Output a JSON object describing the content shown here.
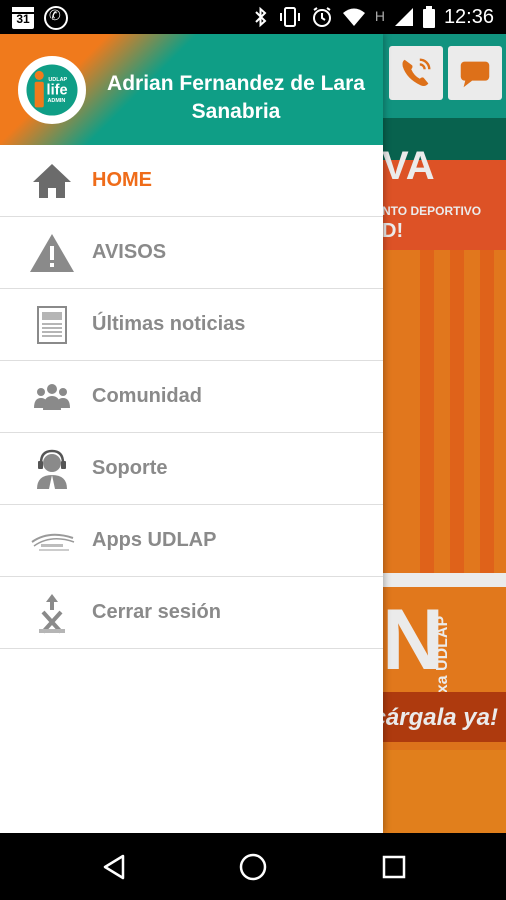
{
  "status_bar": {
    "calendar_date": "31",
    "time": "12:36",
    "network_label": "H",
    "icons": [
      "calendar-icon",
      "whatsapp-icon",
      "bluetooth-icon",
      "vibrate-icon",
      "alarm-icon",
      "wifi-icon",
      "signal-icon",
      "battery-icon"
    ]
  },
  "drawer": {
    "logo": {
      "name": "udlap-life-admin-logo",
      "text_top": "UDLAP",
      "text_main": "life",
      "text_sub": "ADMIN"
    },
    "user_name": "Adrian Fernandez de Lara Sanabria",
    "menu": [
      {
        "label": "HOME",
        "icon": "home-icon",
        "active": true
      },
      {
        "label": "AVISOS",
        "icon": "warning-icon",
        "active": false
      },
      {
        "label": "Últimas noticias",
        "icon": "news-icon",
        "active": false
      },
      {
        "label": "Comunidad",
        "icon": "community-icon",
        "active": false
      },
      {
        "label": "Soporte",
        "icon": "support-icon",
        "active": false
      },
      {
        "label": "Apps UDLAP",
        "icon": "udlap-apps-icon",
        "active": false
      },
      {
        "label": "Cerrar sesión",
        "icon": "logout-icon",
        "active": false
      }
    ]
  },
  "background_app": {
    "header_buttons": [
      "phone-icon",
      "chat-icon"
    ],
    "banner_big_text": "VA",
    "banner_small_text": "NTO DEPORTIVO",
    "banner_small_text2": "D!",
    "banner3_letter": "N",
    "banner3_vertical": "exa UDLAP",
    "banner4_text": "cárgala ya!"
  },
  "colors": {
    "accent_orange": "#ef6c1a",
    "teal": "#0f9e86",
    "menu_text": "#8a8a8a"
  },
  "nav_bar": {
    "buttons": [
      "back-icon",
      "home-circle-icon",
      "recents-icon"
    ]
  }
}
